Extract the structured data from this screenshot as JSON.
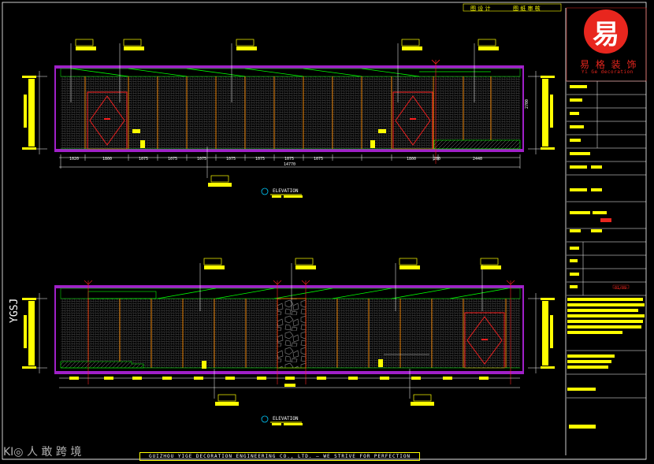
{
  "header": {
    "designer_label": "图 设 计",
    "review_label": "图 纸 审 核"
  },
  "company": {
    "logo_char": "易",
    "name_cn": "易 格 装 饰",
    "name_en": "Yi Ge decoration"
  },
  "footer": {
    "text": "GUIZHOU YIGE DECORATION ENGINEERING CO., LTD. — WE STRIVE FOR PERFECTION"
  },
  "sheet": {
    "number": "01/09"
  },
  "watermark": "KI◎ 人 敢 跨 境",
  "side_label": "YGSJ",
  "elevations": [
    {
      "title": "ELEVATION",
      "dims": [
        "1020",
        "1800",
        "1075",
        "1075",
        "1075",
        "1075",
        "1075",
        "1075",
        "1075",
        "1800",
        "200",
        "2440"
      ],
      "total": "14770",
      "height": "2700"
    },
    {
      "title": "ELEVATION"
    }
  ]
}
